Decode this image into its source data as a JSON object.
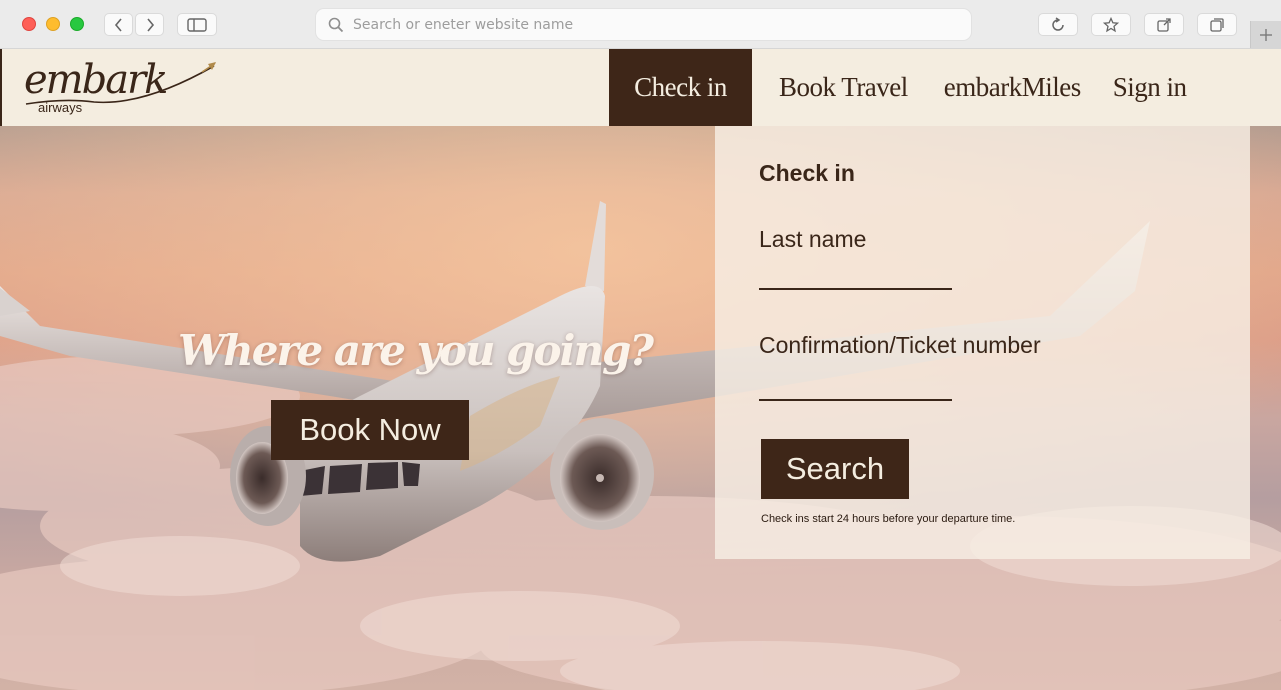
{
  "browser": {
    "address_placeholder": "Search or eneter website name",
    "icons": [
      "back-icon",
      "forward-icon",
      "sidebar-icon",
      "search-icon",
      "reload-icon",
      "star-icon",
      "share-icon",
      "tabs-icon",
      "plus-icon"
    ]
  },
  "brand": {
    "name": "embark",
    "sub": "airways"
  },
  "nav": {
    "checkin": "Check in",
    "book": "Book Travel",
    "miles": "embarkMiles",
    "signin": "Sign in"
  },
  "hero": {
    "headline": "Where are you going?",
    "book_now": "Book Now"
  },
  "checkin": {
    "title": "Check in",
    "last_name_label": "Last name",
    "last_name_value": "",
    "confirmation_label": "Confirmation/Ticket number",
    "confirmation_value": "",
    "search_label": "Search",
    "note": "Check ins start 24 hours before your departure time."
  },
  "colors": {
    "brand_dark": "#3e2618",
    "header_bg": "#f4ede0",
    "panel_bg": "#f6eee4"
  }
}
